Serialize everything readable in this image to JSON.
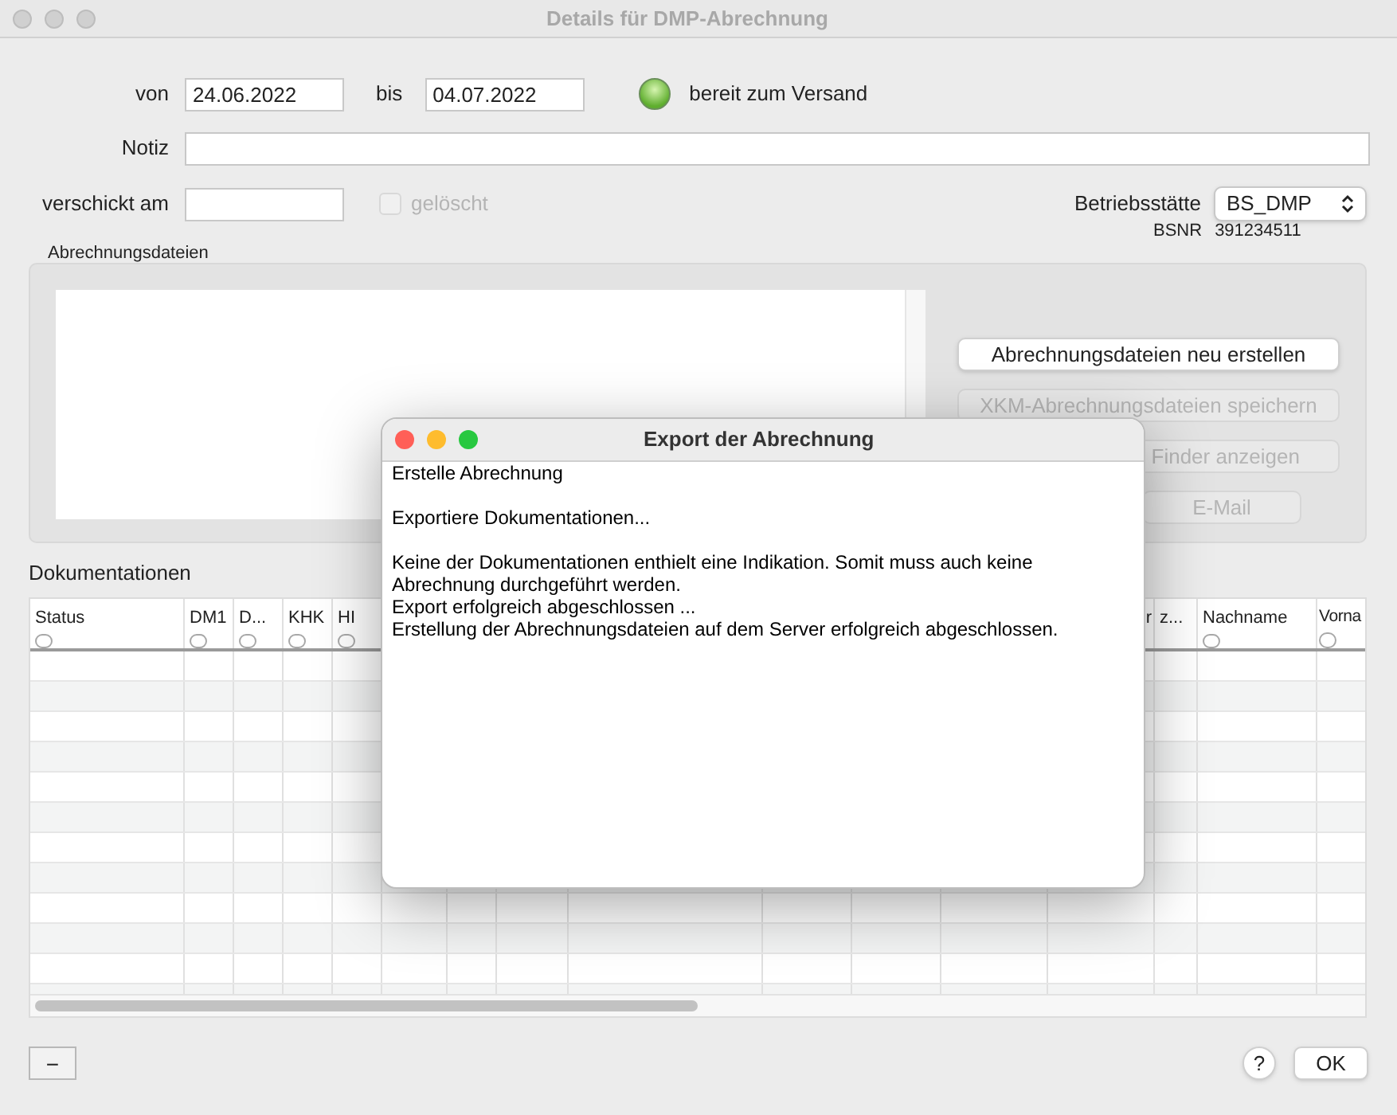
{
  "window": {
    "title": "Details für DMP-Abrechnung"
  },
  "form": {
    "von_label": "von",
    "von": "24.06.2022",
    "bis_label": "bis",
    "bis": "04.07.2022",
    "status_on": true,
    "status_label": "bereit zum Versand",
    "notiz_label": "Notiz",
    "verschickt_label": "verschickt am",
    "geloescht": {
      "label": "gelöscht",
      "checked": false,
      "disabled": true
    },
    "betriebsstaette_label": "Betriebsstätte",
    "betriebsstaette": "BS_DMP",
    "bsnr_label": "BSNR",
    "bsnr": "391234511"
  },
  "files": {
    "title": "Abrechnungsdateien",
    "buttons": [
      {
        "label": "Abrechnungsdateien neu erstellen",
        "disabled": false,
        "kind": "wide"
      },
      {
        "label": "XKM-Abrechnungsdateien speichern",
        "disabled": true,
        "kind": "wide"
      },
      {
        "label": "Finder anzeigen",
        "disabled": true,
        "kind": "wide"
      },
      {
        "label": "E-Mail",
        "disabled": true,
        "kind": "narrow"
      }
    ]
  },
  "table": {
    "title": "Dokumentationen",
    "columns": [
      {
        "label": "Status",
        "radio": true
      },
      {
        "label": "DM1",
        "radio": true
      },
      {
        "label": "D...",
        "radio": true
      },
      {
        "label": "KHK",
        "radio": true
      },
      {
        "label": "HI",
        "radio": true
      },
      {},
      {},
      {},
      {},
      {},
      {},
      {},
      {
        "label": "r"
      },
      {
        "label": "z...",
        "radio": false
      },
      {
        "label": "Nachname",
        "radio": true
      },
      {
        "label": "Vorna",
        "radio": true
      }
    ]
  },
  "bottom": {
    "remove": "−",
    "help": "?",
    "ok": "OK"
  },
  "dialog": {
    "title": "Export der Abrechnung",
    "log": "Erstelle Abrechnung\n\nExportiere Dokumentationen...\n\nKeine der Dokumentationen enthielt eine Indikation. Somit muss auch keine Abrechnung durchgeführt werden.\nExport erfolgreich abgeschlossen ...\nErstellung der Abrechnungsdateien auf dem Server erfolgreich abgeschlossen."
  }
}
